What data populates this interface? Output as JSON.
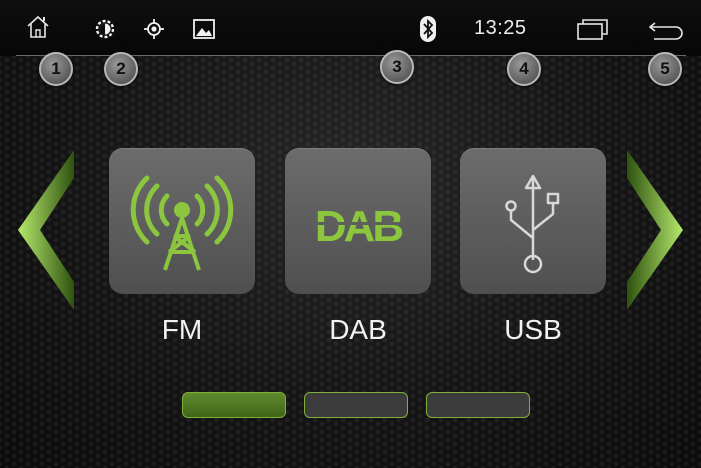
{
  "statusbar": {
    "clock": "13:25",
    "icons": [
      "home-icon",
      "brightness-icon",
      "gps-icon",
      "image-icon",
      "bluetooth-icon",
      "recent-apps-icon",
      "back-icon"
    ]
  },
  "callouts": [
    "1",
    "2",
    "3",
    "4",
    "5"
  ],
  "sources": [
    {
      "label": "FM",
      "icon": "fm-antenna-icon"
    },
    {
      "label": "DAB",
      "icon": "dab-logo-icon",
      "logo_text": "DAB"
    },
    {
      "label": "USB",
      "icon": "usb-icon"
    }
  ],
  "pager": {
    "pages": 3,
    "current": 1
  },
  "colors": {
    "accent": "#8cc63f",
    "tile": "#5e5e5e",
    "background": "#141414"
  }
}
